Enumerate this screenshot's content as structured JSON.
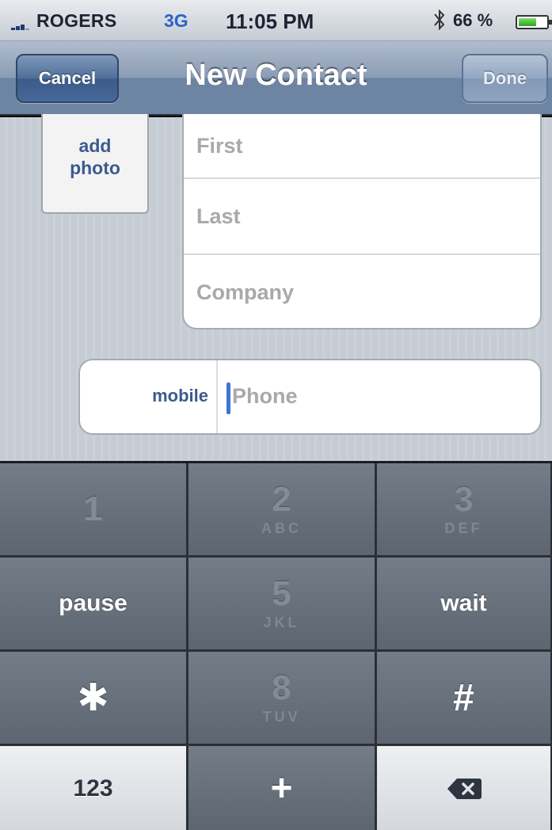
{
  "status_bar": {
    "carrier": "ROGERS",
    "network": "3G",
    "time": "11:05 PM",
    "battery_percent": "66 %",
    "battery_level": 0.66,
    "bluetooth_icon": "bluetooth-icon",
    "signal_icon": "signal-bars-icon"
  },
  "nav_bar": {
    "cancel_label": "Cancel",
    "title": "New Contact",
    "done_label": "Done"
  },
  "form": {
    "add_photo_line1": "add",
    "add_photo_line2": "photo",
    "first_placeholder": "First",
    "last_placeholder": "Last",
    "company_placeholder": "Company",
    "phone_label": "mobile",
    "phone_placeholder": "Phone"
  },
  "keypad": {
    "keys": [
      {
        "digit": "1",
        "letters": ""
      },
      {
        "digit": "2",
        "letters": "ABC"
      },
      {
        "digit": "3",
        "letters": "DEF"
      },
      {
        "word": "pause"
      },
      {
        "digit": "5",
        "letters": "JKL"
      },
      {
        "word": "wait"
      },
      {
        "symbol": "✱"
      },
      {
        "digit": "8",
        "letters": "TUV"
      },
      {
        "symbol": "#"
      },
      {
        "word": "123"
      },
      {
        "symbol": "+"
      },
      {
        "icon": "backspace-icon"
      }
    ]
  },
  "colors": {
    "nav_accent": "#6d84a2",
    "label_blue": "#3c5a8f",
    "cursor_blue": "#3d73d8"
  }
}
